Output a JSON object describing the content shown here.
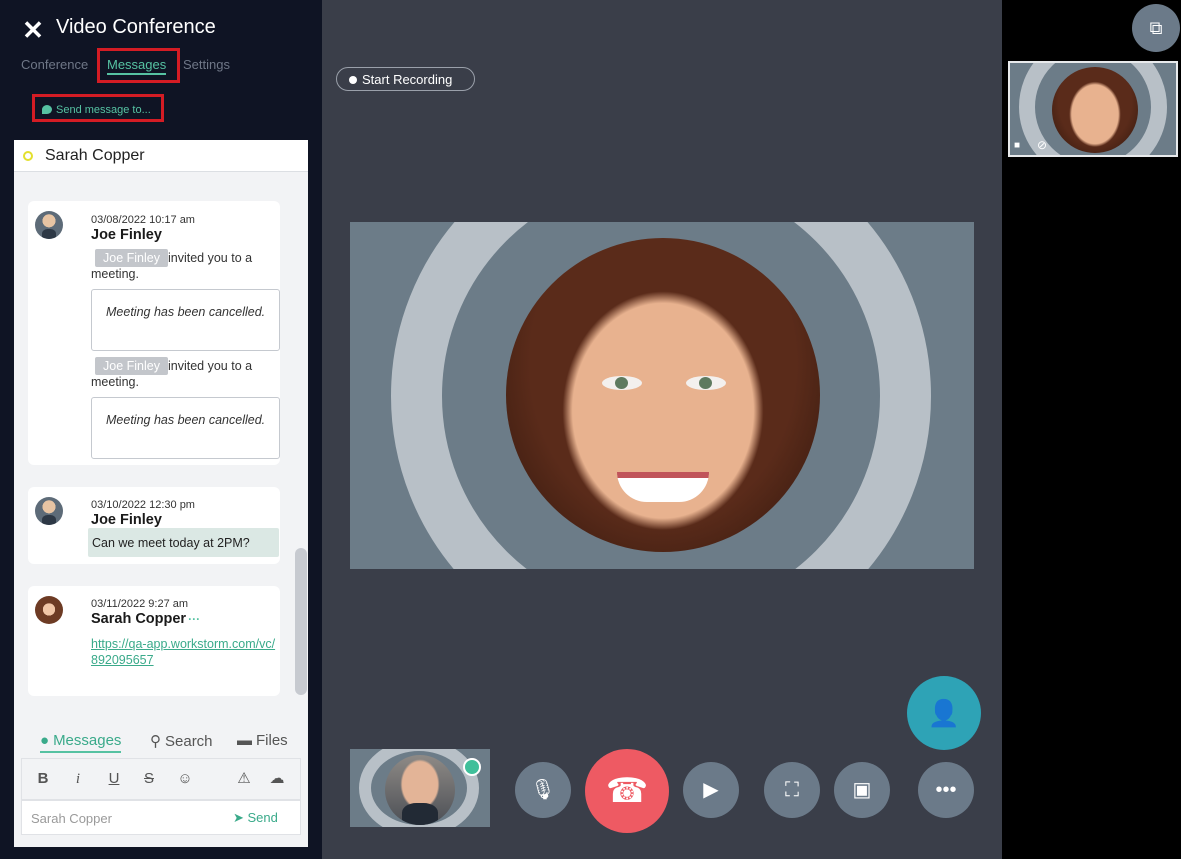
{
  "panel": {
    "title": "Video Conference",
    "close_glyph": "✕",
    "tabs": {
      "conference": "Conference",
      "messages": "Messages",
      "settings": "Settings"
    },
    "send_message_to": "Send message to..."
  },
  "chat": {
    "contact_name": "Sarah Copper",
    "messages": [
      {
        "timestamp": "03/08/2022 10:17 am",
        "author": "Joe Finley",
        "mention_1": "Joe Finley",
        "invite_1": "invited you to a meeting.",
        "cancel_1": "Meeting has been cancelled.",
        "mention_2": "Joe Finley",
        "invite_2": "invited you to a meeting.",
        "cancel_2": "Meeting has been cancelled."
      },
      {
        "timestamp": "03/10/2022 12:30 pm",
        "author": "Joe Finley",
        "text": "Can we meet today at 2PM?"
      },
      {
        "timestamp": "03/11/2022 9:27 am",
        "author": "Sarah Copper",
        "more": "···",
        "link": "https://qa-app.workstorm.com/vc/892095657"
      }
    ],
    "bottom_tabs": {
      "messages": "Messages",
      "search": "Search",
      "files": "Files"
    },
    "composer_placeholder": "Sarah Copper",
    "send_label": "Send"
  },
  "stage": {
    "record_label": "Start Recording"
  },
  "colors": {
    "accent": "#56c2a2",
    "end_call": "#ee5a63",
    "add_person": "#2ea3b6",
    "highlight": "#d41c24"
  },
  "icons": {
    "mic_off": "mic-off-icon",
    "end_call": "phone-hangup-icon",
    "camera_off": "video-off-icon",
    "screen_share": "screen-share-icon",
    "image": "image-icon",
    "more": "more-horizontal-icon",
    "add_person": "add-person-icon",
    "layout": "layout-icon"
  }
}
